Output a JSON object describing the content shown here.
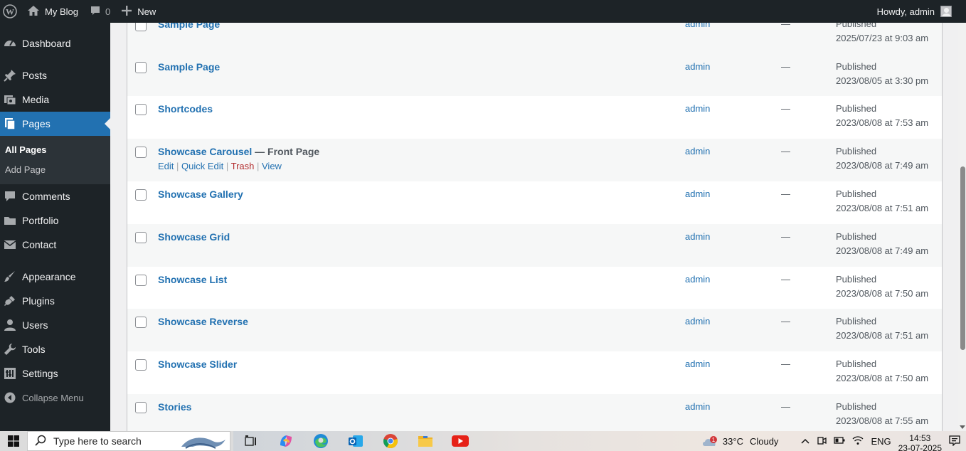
{
  "adminbar": {
    "site_name": "My Blog",
    "comments_count": "0",
    "new_label": "New",
    "howdy": "Howdy, admin"
  },
  "sidebar": {
    "items": [
      {
        "label": "Dashboard",
        "icon": "dashboard-icon"
      },
      {
        "label": "Posts",
        "icon": "pin-icon"
      },
      {
        "label": "Media",
        "icon": "media-icon"
      },
      {
        "label": "Pages",
        "icon": "pages-icon"
      },
      {
        "label": "Comments",
        "icon": "comment-icon"
      },
      {
        "label": "Portfolio",
        "icon": "folder-icon"
      },
      {
        "label": "Contact",
        "icon": "mail-icon"
      },
      {
        "label": "Appearance",
        "icon": "brush-icon"
      },
      {
        "label": "Plugins",
        "icon": "plugin-icon"
      },
      {
        "label": "Users",
        "icon": "user-icon"
      },
      {
        "label": "Tools",
        "icon": "wrench-icon"
      },
      {
        "label": "Settings",
        "icon": "settings-icon"
      }
    ],
    "submenu": {
      "all_pages": "All Pages",
      "add_page": "Add Page"
    },
    "collapse_label": "Collapse Menu"
  },
  "table": {
    "rows": [
      {
        "title": "Sample Page",
        "state": "",
        "author": "admin",
        "comments": "—",
        "status": "Published",
        "date": "2025/07/23 at 9:03 am"
      },
      {
        "title": "Sample Page",
        "state": "",
        "author": "admin",
        "comments": "—",
        "status": "Published",
        "date": "2023/08/05 at 3:30 pm"
      },
      {
        "title": "Shortcodes",
        "state": "",
        "author": "admin",
        "comments": "—",
        "status": "Published",
        "date": "2023/08/08 at 7:53 am"
      },
      {
        "title": "Showcase Carousel",
        "state": " — Front Page",
        "author": "admin",
        "comments": "—",
        "status": "Published",
        "date": "2023/08/08 at 7:49 am"
      },
      {
        "title": "Showcase Gallery",
        "state": "",
        "author": "admin",
        "comments": "—",
        "status": "Published",
        "date": "2023/08/08 at 7:51 am"
      },
      {
        "title": "Showcase Grid",
        "state": "",
        "author": "admin",
        "comments": "—",
        "status": "Published",
        "date": "2023/08/08 at 7:49 am"
      },
      {
        "title": "Showcase List",
        "state": "",
        "author": "admin",
        "comments": "—",
        "status": "Published",
        "date": "2023/08/08 at 7:50 am"
      },
      {
        "title": "Showcase Reverse",
        "state": "",
        "author": "admin",
        "comments": "—",
        "status": "Published",
        "date": "2023/08/08 at 7:51 am"
      },
      {
        "title": "Showcase Slider",
        "state": "",
        "author": "admin",
        "comments": "—",
        "status": "Published",
        "date": "2023/08/08 at 7:50 am"
      },
      {
        "title": "Stories",
        "state": "",
        "author": "admin",
        "comments": "—",
        "status": "Published",
        "date": "2023/08/08 at 7:55 am"
      }
    ],
    "row_actions": {
      "edit": "Edit",
      "quick_edit": "Quick Edit",
      "trash": "Trash",
      "view": "View",
      "separator": " | "
    }
  },
  "taskbar": {
    "search_placeholder": "Type here to search",
    "weather_temp": "33°C",
    "weather_desc": "Cloudy",
    "weather_badge": "1",
    "language": "ENG",
    "time": "14:53",
    "date": "23-07-2025"
  },
  "colors": {
    "accent": "#2271b1",
    "adminbar": "#1d2327",
    "trash": "#b32d2e"
  }
}
